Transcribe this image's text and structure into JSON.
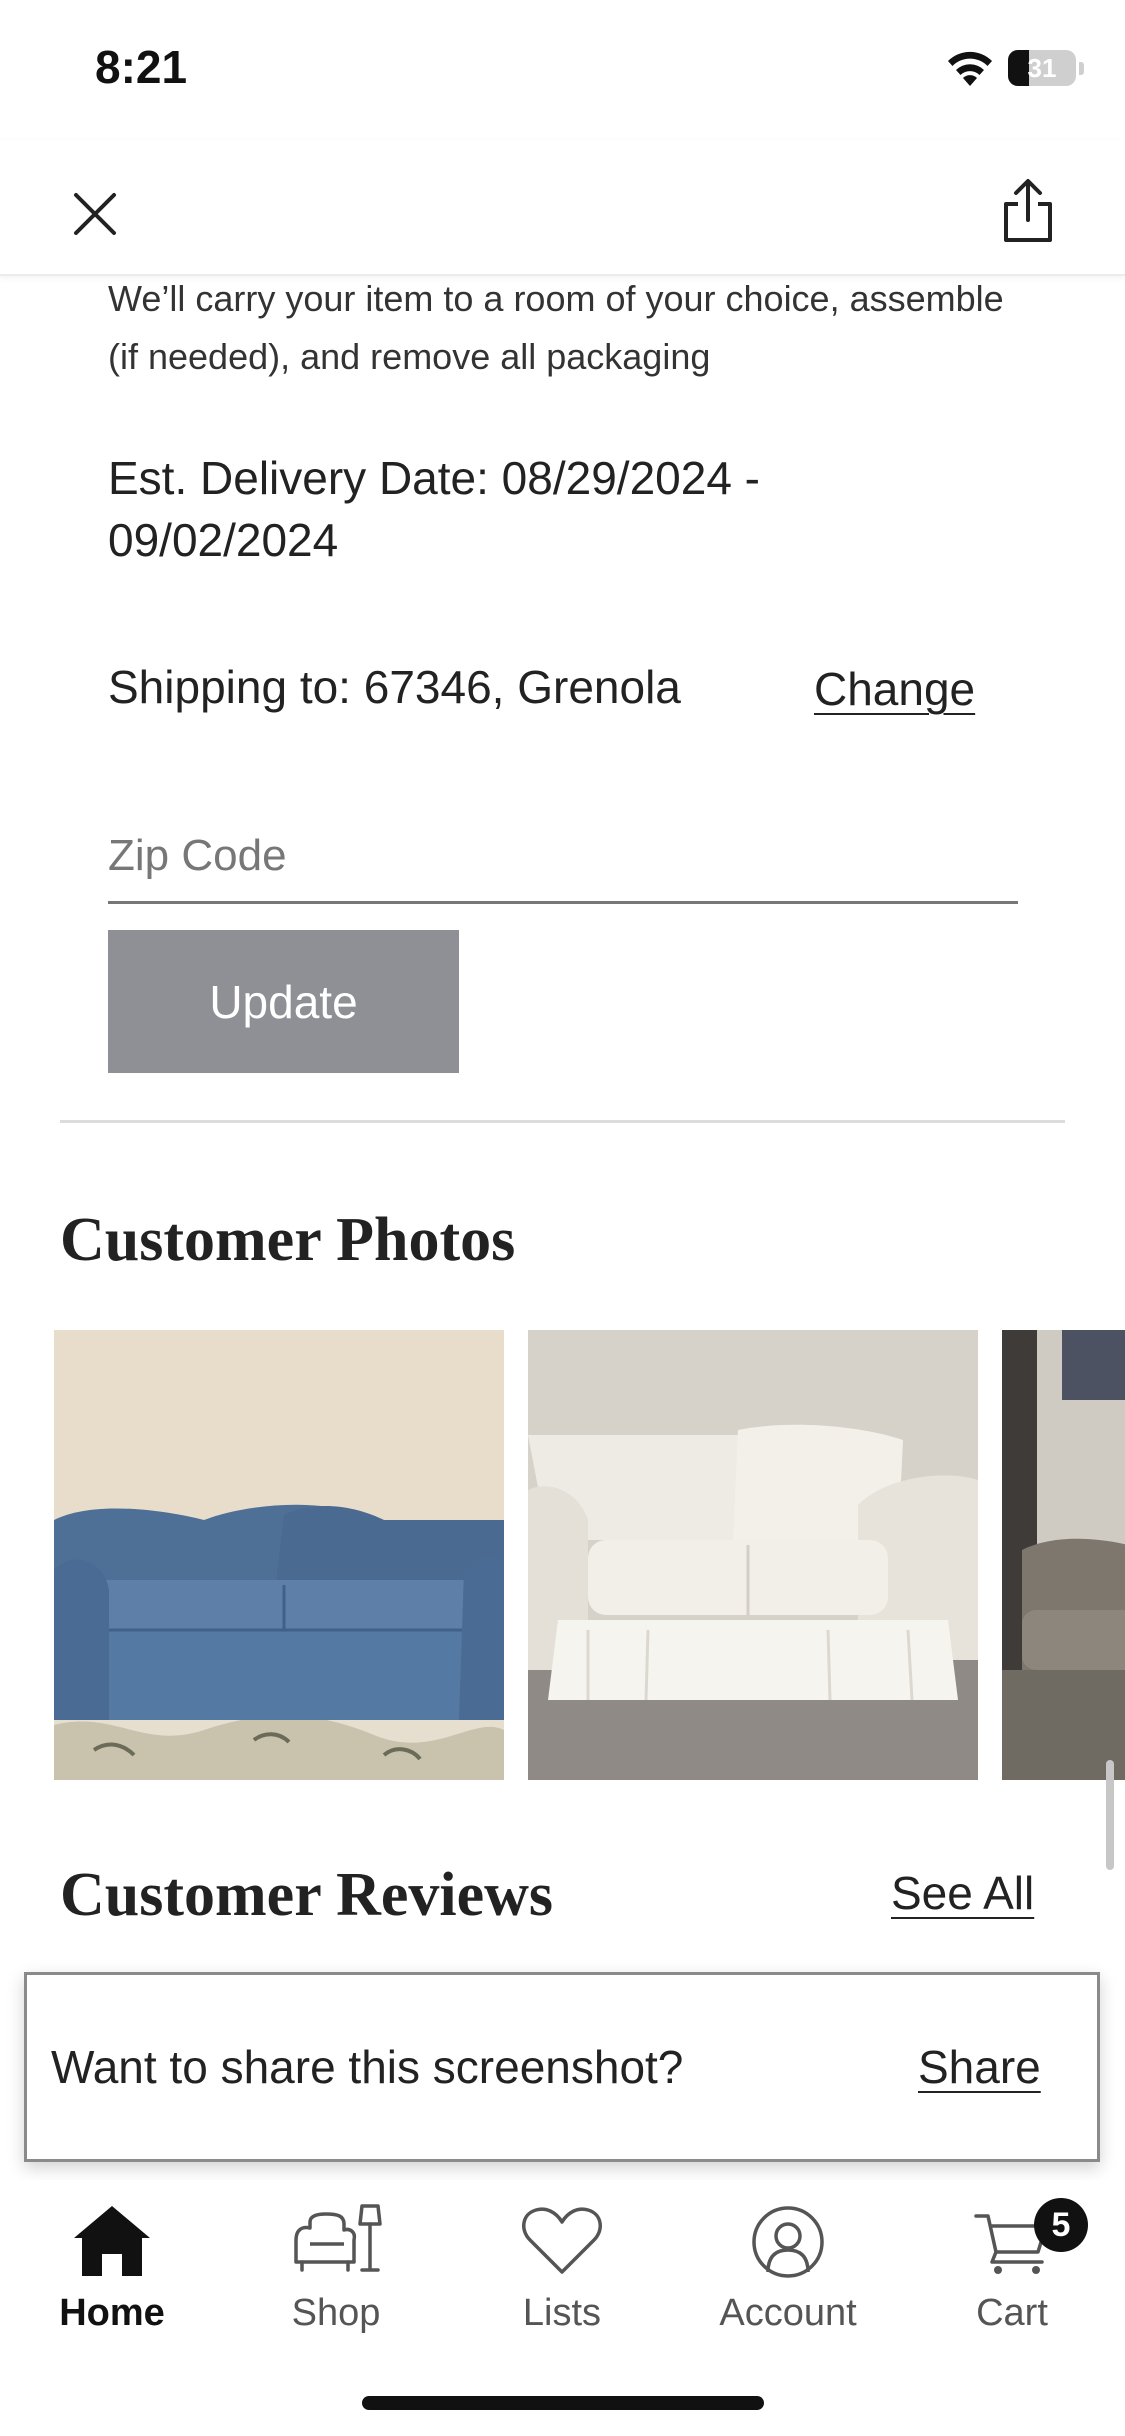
{
  "status_bar": {
    "time": "8:21",
    "battery": "31",
    "battery_level": 0.31
  },
  "header": {
    "close_icon": "close-icon",
    "share_icon": "share-icon"
  },
  "delivery": {
    "description": "We’ll carry your item to a room of your choice, assemble (if needed), and remove all packaging",
    "est_date": "Est. Delivery Date: 08/29/2024 - 09/02/2024",
    "shipping_to": "Shipping to: 67346, Grenola",
    "change_label": "Change",
    "zip_placeholder": "Zip Code",
    "zip_value": "",
    "update_label": "Update"
  },
  "customer_photos": {
    "title": "Customer Photos",
    "photos": [
      {
        "subject": "blue slipcovered sofa"
      },
      {
        "subject": "white slipcovered sofa"
      },
      {
        "subject": "grey sofa (partially visible)"
      }
    ]
  },
  "customer_reviews": {
    "title": "Customer Reviews",
    "see_all_label": "See All"
  },
  "share_banner": {
    "text": "Want to share this screenshot?",
    "share_label": "Share"
  },
  "tab_bar": {
    "tabs": [
      {
        "label": "Home",
        "icon": "home-icon",
        "active": true
      },
      {
        "label": "Shop",
        "icon": "sofa-lamp-icon",
        "active": false
      },
      {
        "label": "Lists",
        "icon": "heart-icon",
        "active": false
      },
      {
        "label": "Account",
        "icon": "account-icon",
        "active": false
      },
      {
        "label": "Cart",
        "icon": "cart-icon",
        "active": false
      }
    ],
    "cart_count": "5"
  },
  "colors": {
    "update_button": "#8e9096",
    "text": "#222222",
    "divider": "#dcdcdc"
  }
}
